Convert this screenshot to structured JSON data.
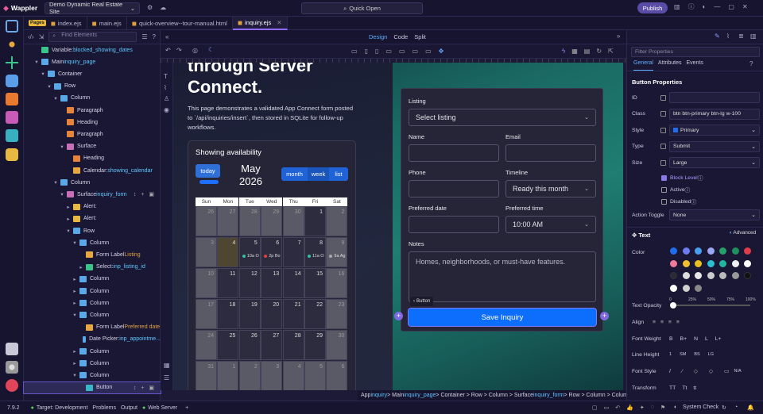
{
  "app": {
    "name": "Wappler",
    "project": "Demo Dynamic Real Estate Site",
    "quick_open": "Quick Open",
    "publish": "Publish"
  },
  "tabs": {
    "pages_label": "Pages",
    "items": [
      {
        "label": "index.ejs"
      },
      {
        "label": "main.ejs"
      },
      {
        "label": "quick-overview--tour-manual.html"
      },
      {
        "label": "inquiry.ejs",
        "active": true
      }
    ]
  },
  "left_panel": {
    "find_placeholder": "Find Elements"
  },
  "tree": [
    {
      "depth": 1,
      "icon": "variable",
      "text": "Variable: ",
      "hl": "blocked_showing_dates",
      "arrow": ""
    },
    {
      "depth": 1,
      "icon": "main",
      "text": "Main ",
      "hl": "inquiry_page",
      "arrow": "v"
    },
    {
      "depth": 2,
      "icon": "container",
      "text": "Container",
      "hl": "",
      "arrow": "v"
    },
    {
      "depth": 3,
      "icon": "row",
      "text": "Row",
      "hl": "",
      "arrow": "v"
    },
    {
      "depth": 4,
      "icon": "column",
      "text": "Column",
      "hl": "",
      "arrow": "v"
    },
    {
      "depth": 5,
      "icon": "paragraph",
      "text": "Paragraph",
      "hl": "",
      "arrow": ""
    },
    {
      "depth": 5,
      "icon": "heading",
      "text": "Heading",
      "hl": "",
      "arrow": ""
    },
    {
      "depth": 5,
      "icon": "paragraph",
      "text": "Paragraph",
      "hl": "",
      "arrow": ""
    },
    {
      "depth": 5,
      "icon": "surface",
      "text": "Surface",
      "hl": "",
      "arrow": "v"
    },
    {
      "depth": 6,
      "icon": "heading",
      "text": "Heading",
      "hl": "",
      "arrow": ""
    },
    {
      "depth": 6,
      "icon": "calendar",
      "text": "Calendar: ",
      "hl": "showing_calendar",
      "arrow": ""
    },
    {
      "depth": 4,
      "icon": "column",
      "text": "Column",
      "hl": "",
      "arrow": "v"
    },
    {
      "depth": 5,
      "icon": "surface",
      "text": "Surface ",
      "hl": "inquiry_form",
      "arrow": "v",
      "tools": "↕ + ▣"
    },
    {
      "depth": 6,
      "icon": "alert",
      "text": "Alert:",
      "hl": "",
      "arrow": ">"
    },
    {
      "depth": 6,
      "icon": "alert",
      "text": "Alert:",
      "hl": "",
      "arrow": ">"
    },
    {
      "depth": 6,
      "icon": "row",
      "text": "Row",
      "hl": "",
      "arrow": "v"
    },
    {
      "depth": 7,
      "icon": "column",
      "text": "Column",
      "hl": "",
      "arrow": "v"
    },
    {
      "depth": 8,
      "icon": "label",
      "text": "Form Label ",
      "hl": "Listing",
      "hl_color": "#e0a040",
      "arrow": ""
    },
    {
      "depth": 8,
      "icon": "select",
      "text": "Select: ",
      "hl": "inp_listing_id",
      "arrow": ">"
    },
    {
      "depth": 7,
      "icon": "column",
      "text": "Column",
      "hl": "",
      "arrow": ">"
    },
    {
      "depth": 7,
      "icon": "column",
      "text": "Column",
      "hl": "",
      "arrow": ">"
    },
    {
      "depth": 7,
      "icon": "column",
      "text": "Column",
      "hl": "",
      "arrow": ">"
    },
    {
      "depth": 7,
      "icon": "column",
      "text": "Column",
      "hl": "",
      "arrow": "v"
    },
    {
      "depth": 8,
      "icon": "label",
      "text": "Form Label ",
      "hl": "Preferred date",
      "hl_color": "#e0a040",
      "arrow": ""
    },
    {
      "depth": 8,
      "icon": "date",
      "text": "Date Picker: ",
      "hl": "inp_appointme...",
      "arrow": ""
    },
    {
      "depth": 7,
      "icon": "column",
      "text": "Column",
      "hl": "",
      "arrow": ">"
    },
    {
      "depth": 7,
      "icon": "column",
      "text": "Column",
      "hl": "",
      "arrow": ">"
    },
    {
      "depth": 7,
      "icon": "column",
      "text": "Column",
      "hl": "",
      "arrow": "v"
    },
    {
      "depth": 8,
      "icon": "button",
      "text": "Button",
      "hl": "",
      "arrow": "",
      "selected": true,
      "tools": "↕ + ▣"
    }
  ],
  "designbar": {
    "modes": [
      "Design",
      "Code",
      "Split"
    ]
  },
  "canvas": {
    "hero_line1": "through Server",
    "hero_line2": "Connect.",
    "hero_para": "This page demonstrates a validated App Connect form posted to `/api/inquiries/insert`, then stored in SQLite for follow-up workflows.",
    "calendar": {
      "title": "Showing availability",
      "today": "today",
      "month_label": "May",
      "year_label": "2026",
      "views": [
        "month",
        "week",
        "list"
      ],
      "dow": [
        "Sun",
        "Mon",
        "Tue",
        "Wed",
        "Thu",
        "Fri",
        "Sat"
      ],
      "weeks": [
        [
          "26",
          "27",
          "28",
          "29",
          "30",
          "1",
          "2"
        ],
        [
          "3",
          "4",
          "5",
          "6",
          "7",
          "8",
          "9"
        ],
        [
          "10",
          "11",
          "12",
          "13",
          "14",
          "15",
          "16"
        ],
        [
          "17",
          "18",
          "19",
          "20",
          "21",
          "22",
          "23"
        ],
        [
          "24",
          "25",
          "26",
          "27",
          "28",
          "29",
          "30"
        ],
        [
          "31",
          "1",
          "2",
          "3",
          "4",
          "5",
          "6"
        ]
      ],
      "events": [
        {
          "week": 1,
          "day": 2,
          "label": "10a O",
          "color": "#34c0a0"
        },
        {
          "week": 1,
          "day": 3,
          "label": "2p Bo",
          "color": "#e04040"
        },
        {
          "week": 1,
          "day": 5,
          "label": "11a O",
          "color": "#34c0a0"
        },
        {
          "week": 1,
          "day": 6,
          "label": "9a Ag",
          "color": "#aaaaaa"
        }
      ]
    },
    "form": {
      "listing_label": "Listing",
      "listing_value": "Select listing",
      "name_label": "Name",
      "email_label": "Email",
      "phone_label": "Phone",
      "timeline_label": "Timeline",
      "timeline_value": "Ready this month",
      "date_label": "Preferred date",
      "time_label": "Preferred time",
      "time_value": "10:00 AM",
      "notes_label": "Notes",
      "notes_placeholder": "Homes, neighborhoods, or must-have features.",
      "badge": "Button",
      "save": "Save Inquiry"
    }
  },
  "pathbar": [
    {
      "t": "App "
    },
    {
      "t": "inquiry",
      "hl": true
    },
    {
      "t": " > Main "
    },
    {
      "t": "inquiry_page",
      "hl": true
    },
    {
      "t": " > Container > Row > Column > Surface "
    },
    {
      "t": "inquiry_form",
      "hl": true
    },
    {
      "t": " > Row > Column > Column > "
    },
    {
      "t": "Button",
      "cur": true
    }
  ],
  "right_panel": {
    "filter_placeholder": "Filter Properties",
    "tabs": [
      "General",
      "Attributes",
      "Events"
    ],
    "section": "Button Properties",
    "props": [
      {
        "label": "ID",
        "value": ""
      },
      {
        "label": "Class",
        "value": "btn btn-primary btn-lg w-100"
      },
      {
        "label": "Style",
        "value": "Primary"
      },
      {
        "label": "Type",
        "value": "Submit"
      },
      {
        "label": "Size",
        "value": "Large"
      }
    ],
    "checks": [
      {
        "label": "Block Level",
        "checked": true
      },
      {
        "label": "Active",
        "checked": false
      },
      {
        "label": "Disabled",
        "checked": false
      }
    ],
    "action_toggle": {
      "label": "Action Toggle",
      "value": "None"
    },
    "text_section": "Text",
    "advanced": "Advanced",
    "color_label": "Color",
    "colors": [
      "#1e6ff0",
      "#6d7cf0",
      "#4a9ef0",
      "#9ba7f5",
      "#24a068",
      "#1f8f60",
      "#e03c4a",
      "#f07a9a",
      "#f0c030",
      "#e8c020",
      "#2dc0d0",
      "#20b8a0",
      "#f0f0f0",
      "#ffffff",
      "#2a2a3a",
      "#dddddd",
      "#e8e8e8",
      "#cccccc",
      "#bbbbbb",
      "#999999",
      "#111111",
      "#ffffff",
      "#d0d0d0",
      "#888888"
    ],
    "opacity_label": "Text Opacity",
    "opacity_ticks": [
      "0",
      "25%",
      "50%",
      "75%",
      "100%"
    ],
    "align_label": "Align",
    "weight_label": "Font Weight",
    "weight_opts": [
      "B",
      "B+",
      "N",
      "L",
      "L+"
    ],
    "lineheight_label": "Line Height",
    "lineheight_opts": [
      "1",
      "SM",
      "BS",
      "LG"
    ],
    "fontstyle_label": "Font Style",
    "fontstyle_na": "N/A",
    "transform_label": "Transform",
    "transform_opts": [
      "TT",
      "Tt",
      "tt"
    ]
  },
  "statusbar": {
    "version": "7.9.2",
    "target": "Target: Development",
    "problems": "Problems",
    "output": "Output",
    "webserver": "Web Server",
    "system_check": "System Check"
  }
}
